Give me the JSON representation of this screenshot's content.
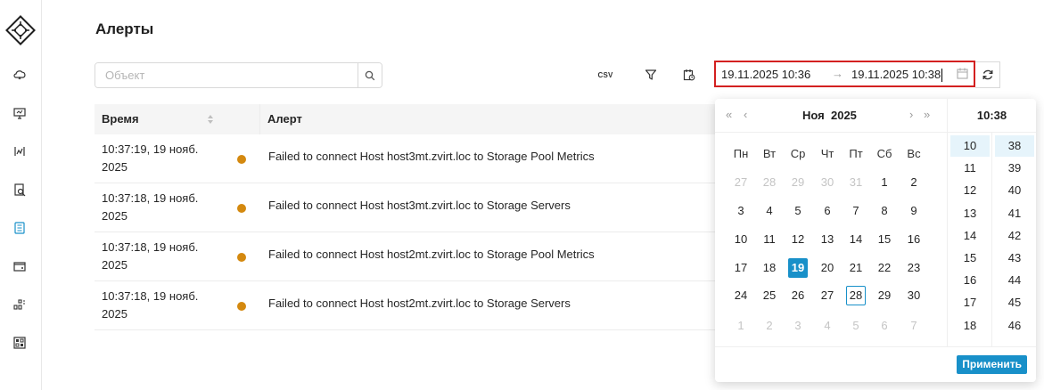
{
  "page": {
    "title": "Алерты"
  },
  "search": {
    "placeholder": "Объект",
    "value": ""
  },
  "toolbar": {
    "csv_label": "CSV"
  },
  "date_range": {
    "start": "19.11.2025 10:36",
    "separator": "→",
    "end": "19.11.2025 10:38"
  },
  "table": {
    "columns": {
      "time": "Время",
      "alert": "Алерт"
    },
    "rows": [
      {
        "time_line1": "10:37:19, 19 нояб.",
        "time_line2": "2025",
        "alert": "Failed to connect Host host3mt.zvirt.loc to Storage Pool Metrics",
        "status_color": "#d4890f"
      },
      {
        "time_line1": "10:37:18, 19 нояб.",
        "time_line2": "2025",
        "alert": "Failed to connect Host host3mt.zvirt.loc to Storage Servers",
        "status_color": "#d4890f"
      },
      {
        "time_line1": "10:37:18, 19 нояб.",
        "time_line2": "2025",
        "alert": "Failed to connect Host host2mt.zvirt.loc to Storage Pool Metrics",
        "status_color": "#d4890f"
      },
      {
        "time_line1": "10:37:18, 19 нояб.",
        "time_line2": "2025",
        "alert": "Failed to connect Host host2mt.zvirt.loc to Storage Servers",
        "status_color": "#d4890f"
      }
    ]
  },
  "calendar": {
    "nav": {
      "prev_year": "«",
      "prev_month": "‹",
      "next_month": "›",
      "next_year": "»"
    },
    "month": "Ноя",
    "year": "2025",
    "weekdays": [
      "Пн",
      "Вт",
      "Ср",
      "Чт",
      "Пт",
      "Сб",
      "Вс"
    ],
    "weeks": [
      [
        "27",
        "28",
        "29",
        "30",
        "31",
        "1",
        "2"
      ],
      [
        "3",
        "4",
        "5",
        "6",
        "7",
        "8",
        "9"
      ],
      [
        "10",
        "11",
        "12",
        "13",
        "14",
        "15",
        "16"
      ],
      [
        "17",
        "18",
        "19",
        "20",
        "21",
        "22",
        "23"
      ],
      [
        "24",
        "25",
        "26",
        "27",
        "28",
        "29",
        "30"
      ],
      [
        "1",
        "2",
        "3",
        "4",
        "5",
        "6",
        "7"
      ]
    ],
    "selected_day": "19",
    "today_day": "28",
    "time": "10:38",
    "hours": [
      "10",
      "11",
      "12",
      "13",
      "14",
      "15",
      "16",
      "17",
      "18"
    ],
    "minutes": [
      "38",
      "39",
      "40",
      "41",
      "42",
      "43",
      "44",
      "45",
      "46"
    ],
    "selected_hour": "10",
    "selected_minute": "38",
    "apply_label": "Применить"
  },
  "colors": {
    "accent": "#1890c9",
    "warning": "#d4890f",
    "highlight_border": "#d32020"
  },
  "sidebar": {
    "icons": [
      "cloud-icon",
      "monitor-icon",
      "analytics-icon",
      "search-report-icon",
      "alerts-list-icon",
      "wallet-icon",
      "network-icon",
      "dashboard-icon"
    ]
  }
}
